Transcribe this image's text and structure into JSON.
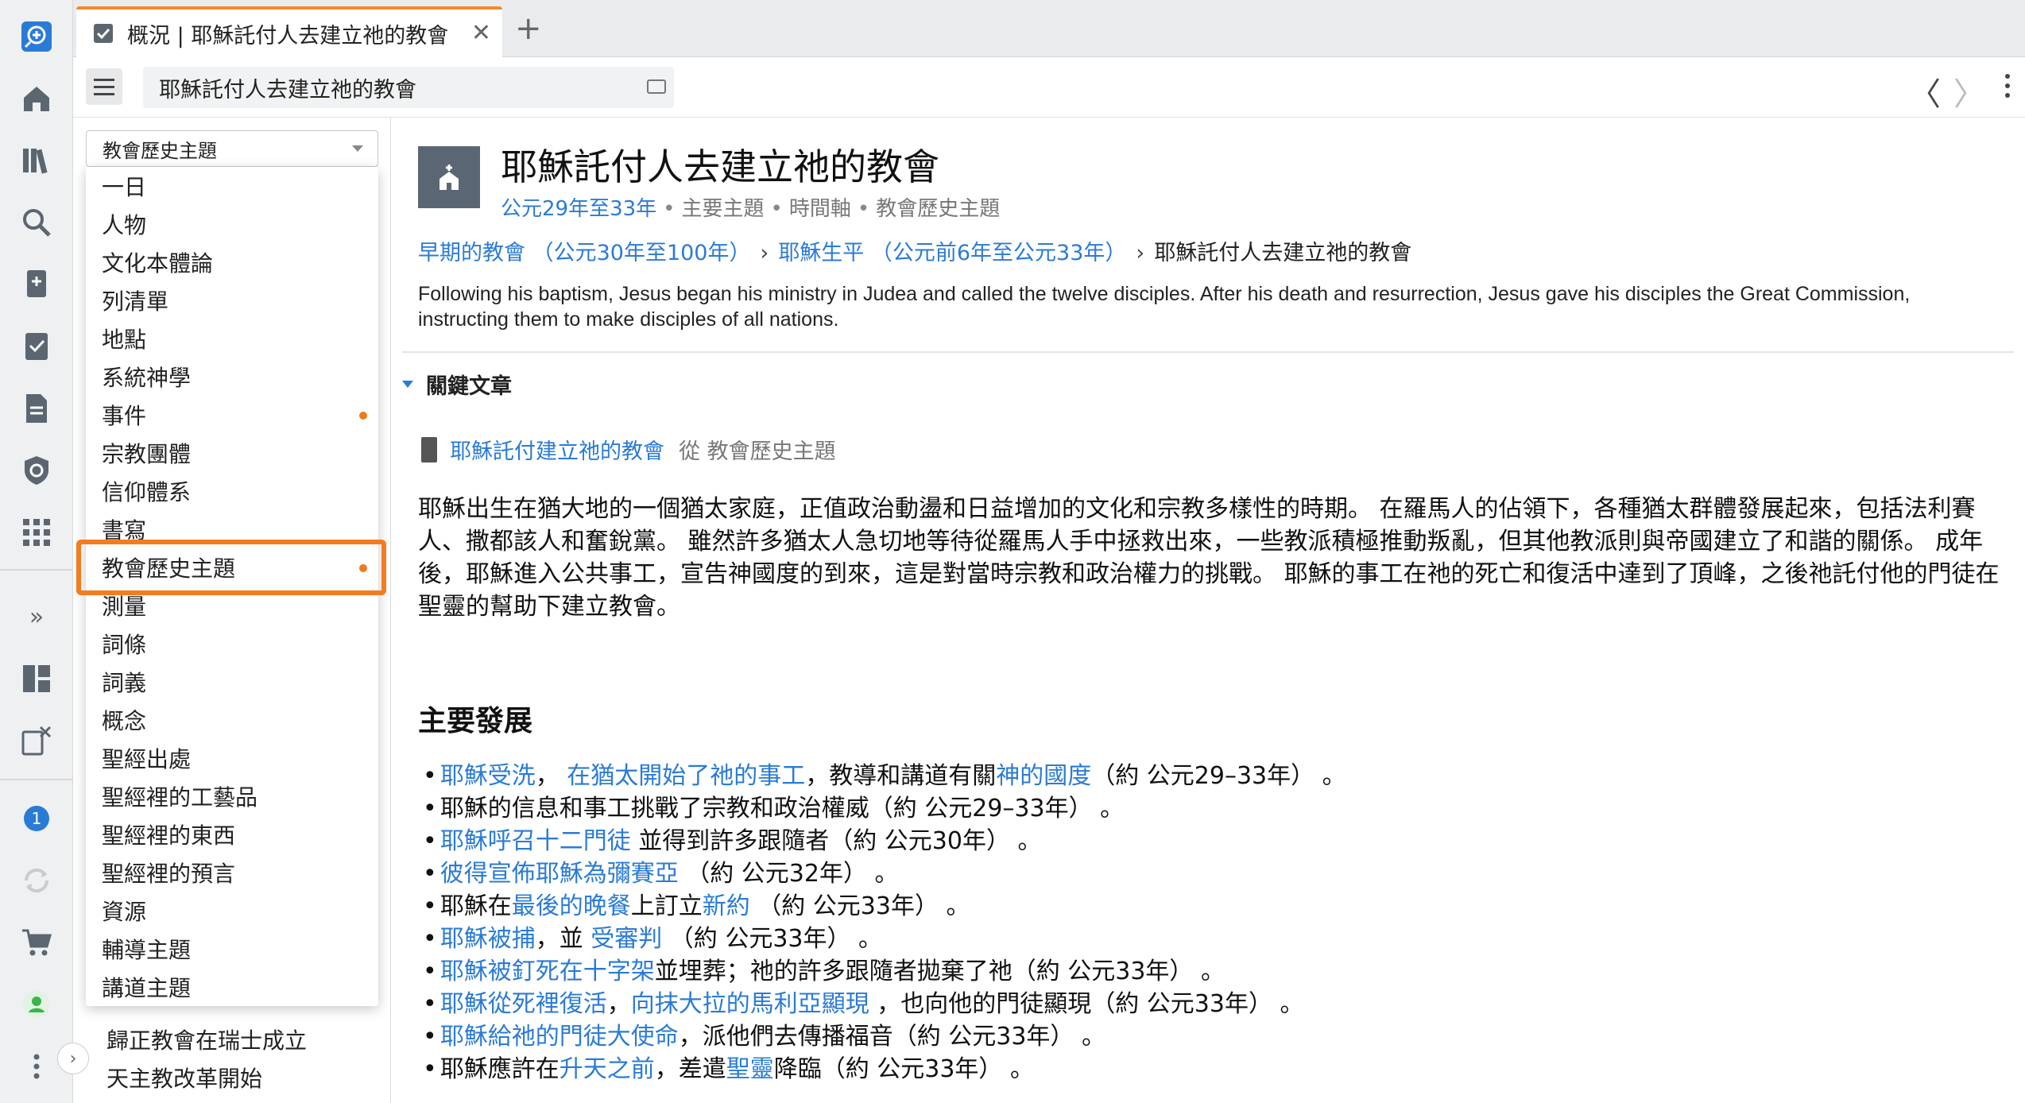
{
  "tab": {
    "title": "概況 | 耶穌託付人去建立祂的教會",
    "close": "✕",
    "add": "+"
  },
  "toolbar": {
    "reference": "耶穌託付人去建立祂的教會",
    "back": "〈",
    "forward": "〉"
  },
  "rail": {
    "icons": [
      "add-search-icon",
      "home-icon",
      "library-icon",
      "search-icon",
      "bookmark-icon",
      "checklist-icon",
      "document-icon",
      "shield-icon",
      "apps-grid-icon",
      "expand-icon",
      "layout-icon",
      "clipboard-close-icon",
      "notification-icon",
      "sync-icon",
      "cart-icon",
      "user-icon",
      "more-vertical-icon"
    ],
    "badge": "1",
    "expand": "»"
  },
  "left": {
    "select_label": "教會歷史主題",
    "behind_items": [
      "歸正教會在瑞士成立",
      "天主教改革開始"
    ],
    "toggle": "›"
  },
  "dropdown": {
    "items": [
      {
        "label": "一日",
        "dot": false
      },
      {
        "label": "人物",
        "dot": false
      },
      {
        "label": "文化本體論",
        "dot": false
      },
      {
        "label": "列清單",
        "dot": false
      },
      {
        "label": "地點",
        "dot": false
      },
      {
        "label": "系統神學",
        "dot": false
      },
      {
        "label": "事件",
        "dot": true
      },
      {
        "label": "宗教團體",
        "dot": false
      },
      {
        "label": "信仰體系",
        "dot": false
      },
      {
        "label": "書寫",
        "dot": false
      },
      {
        "label": "教會歷史主題",
        "dot": true
      },
      {
        "label": "測量",
        "dot": false
      },
      {
        "label": "詞條",
        "dot": false
      },
      {
        "label": "詞義",
        "dot": false
      },
      {
        "label": "概念",
        "dot": false
      },
      {
        "label": "聖經出處",
        "dot": false
      },
      {
        "label": "聖經裡的工藝品",
        "dot": false
      },
      {
        "label": "聖經裡的東西",
        "dot": false
      },
      {
        "label": "聖經裡的預言",
        "dot": false
      },
      {
        "label": "資源",
        "dot": false
      },
      {
        "label": "輔導主題",
        "dot": false
      },
      {
        "label": "講道主題",
        "dot": false
      }
    ],
    "selected": "教會歷史主題",
    "accent": "#f57b20"
  },
  "article": {
    "title": "耶穌託付人去建立祂的教會",
    "meta": {
      "date": "公元29年至33年",
      "tags": [
        "主要主題",
        "時間軸",
        "教會歷史主題"
      ]
    },
    "breadcrumb": [
      "早期的教會 （公元30年至100年）",
      "耶穌生平 （公元前6年至公元33年）",
      "耶穌託付人去建立祂的教會"
    ],
    "summary": "Following his baptism, Jesus began his ministry in Judea and called the twelve disciples. After his death and resurrection, Jesus gave his disciples the Great Commission, instructing them to make disciples of all nations.",
    "key_section": "關鍵文章",
    "key_article": {
      "link": "耶穌託付建立祂的教會",
      "from": "從 教會歷史主題"
    },
    "body": "耶穌出生在猶大地的一個猶太家庭，正值政治動盪和日益增加的文化和宗教多樣性的時期。 在羅馬人的佔領下，各種猶太群體發展起來，包括法利賽人、撒都該人和奮銳黨。 雖然許多猶太人急切地等待從羅馬人手中拯救出來，一些教派積極推動叛亂，但其他教派則與帝國建立了和諧的關係。 成年後，耶穌進入公共事工，宣告神國度的到來，這是對當時宗教和政治權力的挑戰。 耶穌的事工在祂的死亡和復活中達到了頂峰，之後祂託付他的門徒在聖靈的幫助下建立教會。",
    "dev_heading": "主要發展",
    "developments": [
      [
        {
          "t": "耶穌受洗",
          "l": true
        },
        {
          "t": "， ",
          "l": false
        },
        {
          "t": "在猶太開始了祂的事工",
          "l": true
        },
        {
          "t": "，教導和講道有關",
          "l": false
        },
        {
          "t": "神的國度",
          "l": true
        },
        {
          "t": "（約 公元29–33年） 。",
          "l": false
        }
      ],
      [
        {
          "t": "耶穌的信息和事工挑戰了宗教和政治權威（約 公元29–33年） 。",
          "l": false
        }
      ],
      [
        {
          "t": "耶穌呼召十二門徒",
          "l": true
        },
        {
          "t": " 並得到許多跟隨者（約 公元30年） 。",
          "l": false
        }
      ],
      [
        {
          "t": "彼得宣佈耶穌為彌賽亞",
          "l": true
        },
        {
          "t": " （約 公元32年） 。",
          "l": false
        }
      ],
      [
        {
          "t": "耶穌在",
          "l": false
        },
        {
          "t": "最後的晚餐",
          "l": true
        },
        {
          "t": "上訂立",
          "l": false
        },
        {
          "t": "新約",
          "l": true
        },
        {
          "t": " （約 公元33年） 。",
          "l": false
        }
      ],
      [
        {
          "t": "耶穌被捕",
          "l": true
        },
        {
          "t": "，並 ",
          "l": false
        },
        {
          "t": "受審判",
          "l": true
        },
        {
          "t": " （約 公元33年） 。",
          "l": false
        }
      ],
      [
        {
          "t": "耶穌被釘死在十字架",
          "l": true
        },
        {
          "t": "並埋葬；祂的許多跟隨者拋棄了祂（約 公元33年） 。",
          "l": false
        }
      ],
      [
        {
          "t": "耶穌從死裡復活",
          "l": true
        },
        {
          "t": "，",
          "l": false
        },
        {
          "t": "向抹大拉的馬利亞顯現",
          "l": true
        },
        {
          "t": " ，也向他的門徒顯現（約 公元33年） 。",
          "l": false
        }
      ],
      [
        {
          "t": "耶穌給祂的門徒大使命",
          "l": true
        },
        {
          "t": "，派他們去傳播福音（約 公元33年） 。",
          "l": false
        }
      ],
      [
        {
          "t": "耶穌應許在",
          "l": false
        },
        {
          "t": "升天之前",
          "l": true
        },
        {
          "t": "，差遣",
          "l": false
        },
        {
          "t": "聖靈",
          "l": true
        },
        {
          "t": "降臨（約 公元33年） 。",
          "l": false
        }
      ]
    ],
    "link_color": "#2a7bd6"
  }
}
